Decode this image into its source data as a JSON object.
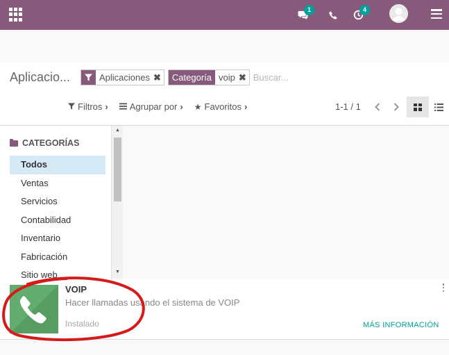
{
  "navbar": {
    "icons": [
      "apps-grid-icon",
      "chat-icon",
      "phone-icon",
      "activity-clock-icon",
      "avatar",
      "hamburger-menu-icon"
    ],
    "chat_badge": "1",
    "activity_badge": "4"
  },
  "breadcrumb": {
    "label": "Aplicaciones"
  },
  "control_panel": {
    "title": "Aplicacio...",
    "facets": [
      {
        "icon": "filter-icon",
        "values": "Aplicaciones"
      },
      {
        "label": "Categoría",
        "values": "voip"
      }
    ],
    "search_placeholder": "Buscar...",
    "filters_label": "Filtros",
    "group_by_label": "Agrupar por",
    "favorites_label": "Favoritos",
    "pager": "1-1 / 1",
    "active_view": "kanban"
  },
  "sidebar": {
    "title": "CATEGORÍAS",
    "items": [
      {
        "label": "Todos",
        "active": true
      },
      {
        "label": "Ventas"
      },
      {
        "label": "Servicios"
      },
      {
        "label": "Contabilidad"
      },
      {
        "label": "Inventario"
      },
      {
        "label": "Fabricación"
      },
      {
        "label": "Sitio web"
      }
    ]
  },
  "app_card": {
    "name": "VOIP",
    "summary": "Hacer llamadas usando el sistema de VOIP",
    "status": "Instalado",
    "more_info": "MÁS INFORMACIÓN",
    "icon": "phone-icon"
  },
  "colors": {
    "brand": "#875a7b",
    "accent": "#00a09d",
    "annotation": "#d61a1a"
  }
}
